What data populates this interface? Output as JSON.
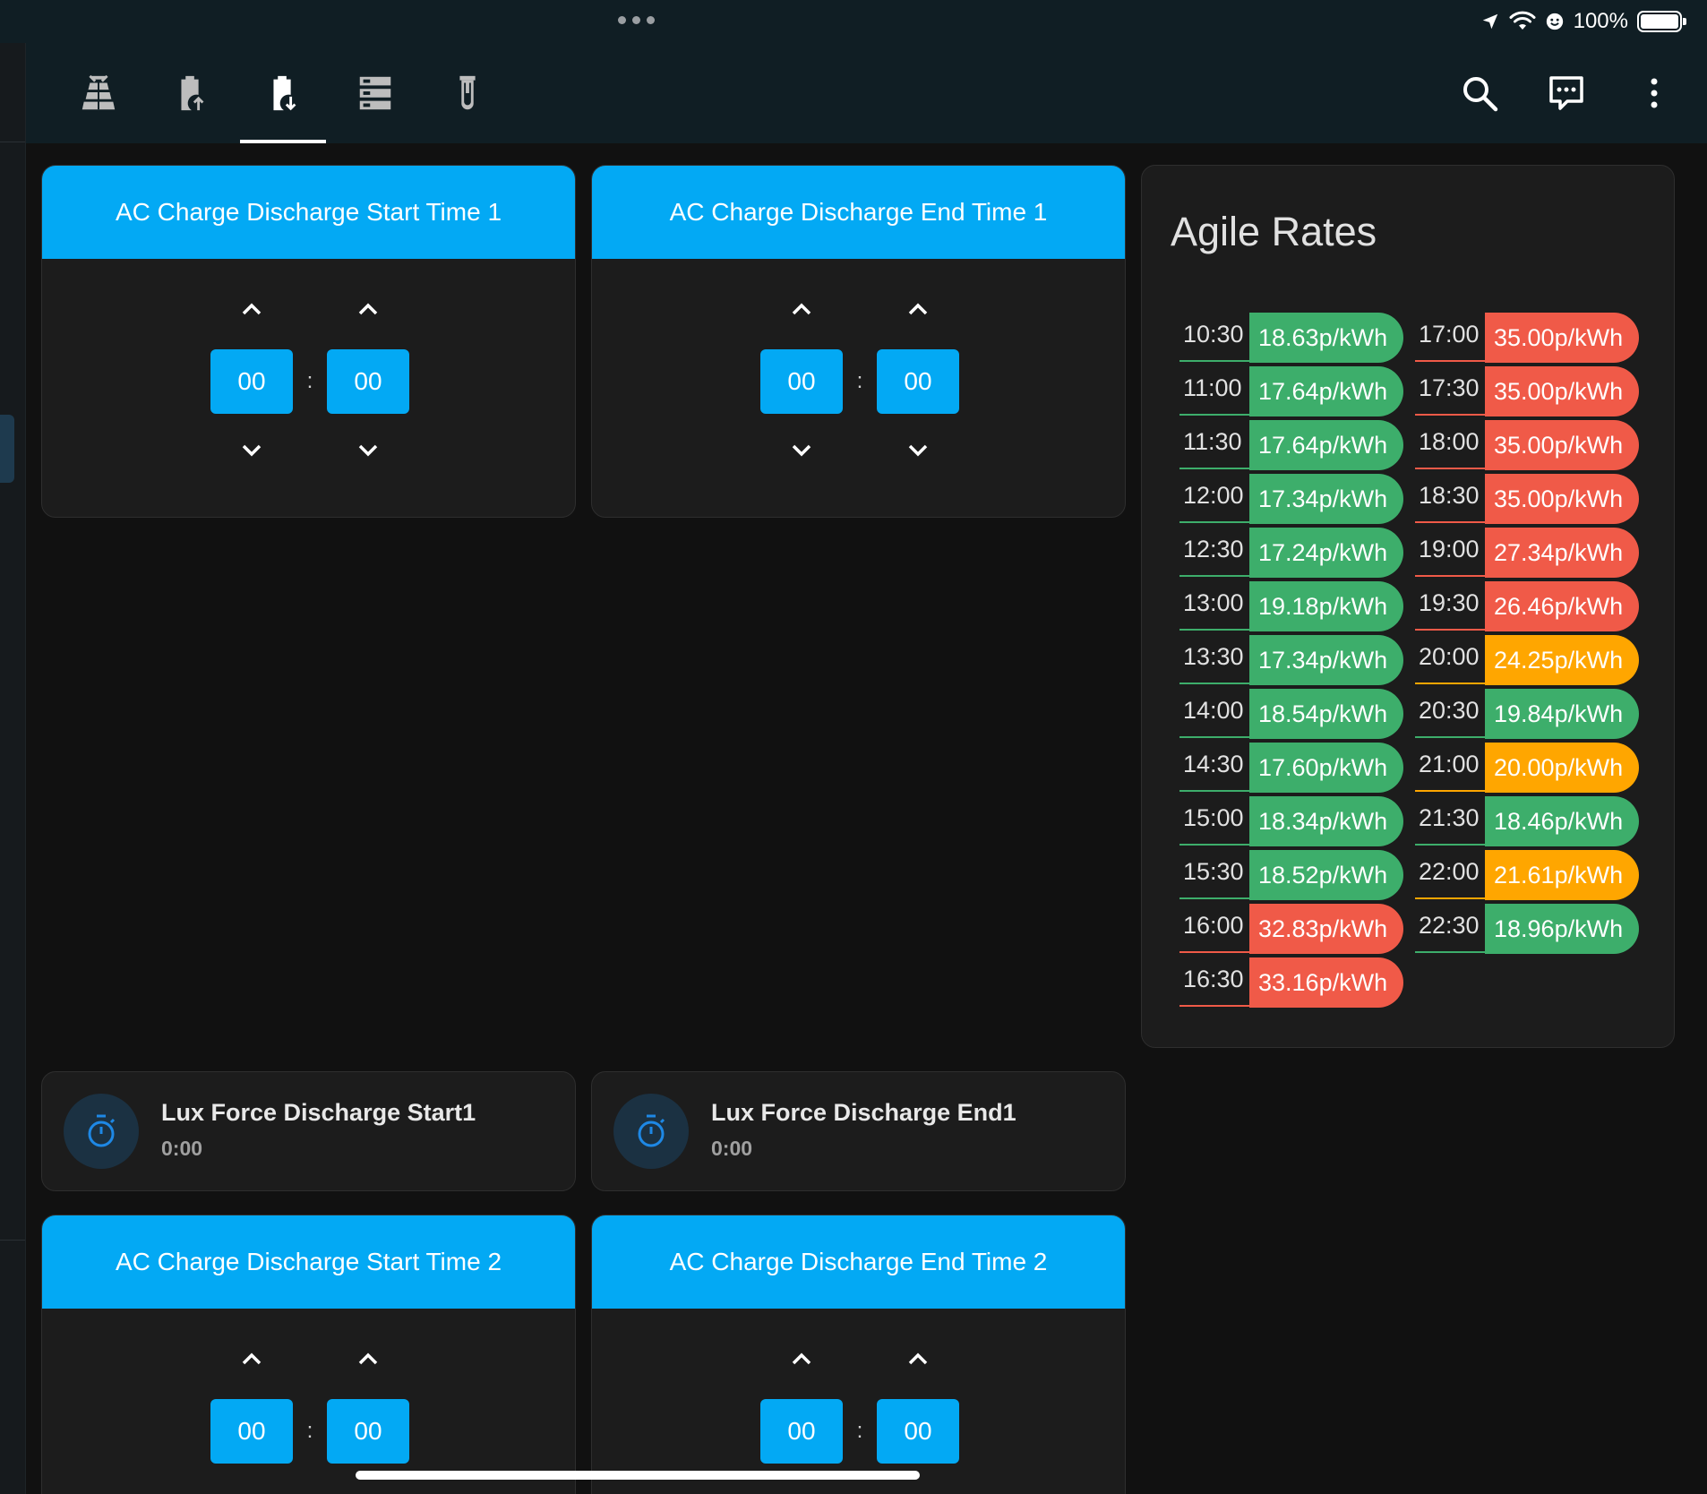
{
  "status": {
    "battery_text": "100%"
  },
  "toolbar": {
    "tabs": [
      {
        "icon": "solar-power-icon"
      },
      {
        "icon": "battery-charging-up-icon"
      },
      {
        "icon": "battery-charging-down-icon",
        "active": true
      },
      {
        "icon": "server-icon"
      },
      {
        "icon": "test-tube-icon"
      }
    ],
    "actions": [
      "search-icon",
      "assist-chat-icon",
      "more-vertical-icon"
    ]
  },
  "timers": [
    {
      "title": "AC Charge Discharge Start Time 1",
      "hours": "00",
      "minutes": "00",
      "separator": ":"
    },
    {
      "title": "AC Charge Discharge End Time 1",
      "hours": "00",
      "minutes": "00",
      "separator": ":"
    },
    {
      "title": "AC Charge Discharge Start Time 2",
      "hours": "00",
      "minutes": "00",
      "separator": ":"
    },
    {
      "title": "AC Charge Discharge End Time 2",
      "hours": "00",
      "minutes": "00",
      "separator": ":"
    }
  ],
  "entities": [
    {
      "name": "Lux Force Discharge Start1",
      "state": "0:00",
      "icon": "timer-icon"
    },
    {
      "name": "Lux Force Discharge End1",
      "state": "0:00",
      "icon": "timer-icon"
    }
  ],
  "agile": {
    "title": "Agile Rates",
    "colors": {
      "green": "#3dae6b",
      "red": "#f05a48",
      "orange": "#ffa600"
    },
    "rates": [
      {
        "time": "10:30",
        "price": "18.63p/kWh",
        "level": "green"
      },
      {
        "time": "11:00",
        "price": "17.64p/kWh",
        "level": "green"
      },
      {
        "time": "11:30",
        "price": "17.64p/kWh",
        "level": "green"
      },
      {
        "time": "12:00",
        "price": "17.34p/kWh",
        "level": "green"
      },
      {
        "time": "12:30",
        "price": "17.24p/kWh",
        "level": "green"
      },
      {
        "time": "13:00",
        "price": "19.18p/kWh",
        "level": "green"
      },
      {
        "time": "13:30",
        "price": "17.34p/kWh",
        "level": "green"
      },
      {
        "time": "14:00",
        "price": "18.54p/kWh",
        "level": "green"
      },
      {
        "time": "14:30",
        "price": "17.60p/kWh",
        "level": "green"
      },
      {
        "time": "15:00",
        "price": "18.34p/kWh",
        "level": "green"
      },
      {
        "time": "15:30",
        "price": "18.52p/kWh",
        "level": "green"
      },
      {
        "time": "16:00",
        "price": "32.83p/kWh",
        "level": "red"
      },
      {
        "time": "16:30",
        "price": "33.16p/kWh",
        "level": "red"
      },
      {
        "time": "17:00",
        "price": "35.00p/kWh",
        "level": "red"
      },
      {
        "time": "17:30",
        "price": "35.00p/kWh",
        "level": "red"
      },
      {
        "time": "18:00",
        "price": "35.00p/kWh",
        "level": "red"
      },
      {
        "time": "18:30",
        "price": "35.00p/kWh",
        "level": "red"
      },
      {
        "time": "19:00",
        "price": "27.34p/kWh",
        "level": "red"
      },
      {
        "time": "19:30",
        "price": "26.46p/kWh",
        "level": "red"
      },
      {
        "time": "20:00",
        "price": "24.25p/kWh",
        "level": "orange"
      },
      {
        "time": "20:30",
        "price": "19.84p/kWh",
        "level": "green"
      },
      {
        "time": "21:00",
        "price": "20.00p/kWh",
        "level": "orange"
      },
      {
        "time": "21:30",
        "price": "18.46p/kWh",
        "level": "green"
      },
      {
        "time": "22:00",
        "price": "21.61p/kWh",
        "level": "orange"
      },
      {
        "time": "22:30",
        "price": "18.96p/kWh",
        "level": "green"
      }
    ]
  }
}
